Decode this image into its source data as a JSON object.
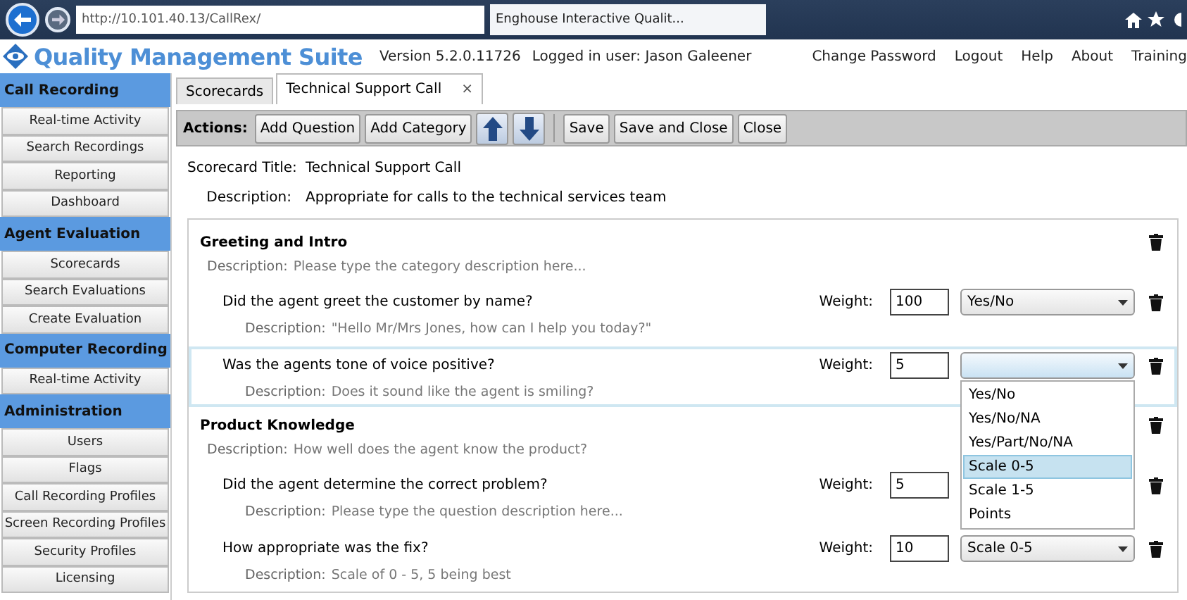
{
  "browser": {
    "address": "http://10.101.40.13/CallRex/",
    "tab_title": "Enghouse Interactive Qualit..."
  },
  "header": {
    "app_title": "Quality Management Suite",
    "version": "Version  5.2.0.11726",
    "user": "Logged in user:  Jason Galeener",
    "links": [
      "Change Password",
      "Logout",
      "Help",
      "About",
      "Training"
    ]
  },
  "sidebar": [
    {
      "title": "Call Recording",
      "items": [
        "Real-time Activity",
        "Search Recordings",
        "Reporting",
        "Dashboard"
      ]
    },
    {
      "title": "Agent Evaluation",
      "items": [
        "Scorecards",
        "Search Evaluations",
        "Create Evaluation"
      ]
    },
    {
      "title": "Computer Recording",
      "items": [
        "Real-time Activity"
      ]
    },
    {
      "title": "Administration",
      "items": [
        "Users",
        "Flags",
        "Call Recording Profiles",
        "Screen Recording Profiles",
        "Security Profiles",
        "Licensing"
      ]
    }
  ],
  "tabs": [
    {
      "label": "Scorecards",
      "selected": false
    },
    {
      "label": "Technical Support Call",
      "selected": true,
      "close": "×"
    }
  ],
  "actions": {
    "label": "Actions:",
    "buttons": [
      {
        "kind": "text",
        "label": "Add Question"
      },
      {
        "kind": "text",
        "label": "Add Category"
      },
      {
        "kind": "up"
      },
      {
        "kind": "down"
      },
      {
        "kind": "separator"
      },
      {
        "kind": "text",
        "label": "Save"
      },
      {
        "kind": "text",
        "label": "Save and Close"
      },
      {
        "kind": "text",
        "label": "Close"
      }
    ]
  },
  "scorecard": {
    "title_label": "Scorecard Title:",
    "title": "Technical Support Call",
    "description_label": "Description:",
    "description": "Appropriate for calls to the technical services team"
  },
  "categories": [
    {
      "name": "Greeting and Intro",
      "description_label": "Description:",
      "description": "Please type the category description here...",
      "questions": [
        {
          "text": "Did the agent greet the customer by name?",
          "description_label": "Description:",
          "description": "\"Hello Mr/Mrs Jones, how can I help you today?\"",
          "weight_label": "Weight:",
          "weight": "100",
          "scale": "Yes/No",
          "selected": false
        },
        {
          "text": "Was the agents tone of voice positive?",
          "description_label": "Description:",
          "description": "Does it sound like the agent is smiling?",
          "weight_label": "Weight:",
          "weight": "5",
          "selected": true
        }
      ]
    },
    {
      "name": "Product Knowledge",
      "description_label": "Description:",
      "description": "How well does the agent know the product?",
      "questions": [
        {
          "text": "Did the agent determine the correct problem?",
          "description_label": "Description:",
          "description": "Please type the question description here...",
          "weight_label": "Weight:",
          "weight": "5",
          "selected": false
        },
        {
          "text": "How appropriate was the fix?",
          "description_label": "Description:",
          "description": "Scale of 0 - 5, 5 being best",
          "weight_label": "Weight:",
          "weight": "10",
          "scale": "Scale 0-5",
          "selected": false
        }
      ]
    }
  ],
  "dropdown": {
    "options": [
      {
        "label": "Yes/No",
        "selected": false
      },
      {
        "label": "Yes/No/NA",
        "selected": false
      },
      {
        "label": "Yes/Part/No/NA",
        "selected": false
      },
      {
        "label": "Scale 0-5",
        "selected": true
      },
      {
        "label": "Scale 1-5",
        "selected": false
      },
      {
        "label": "Points",
        "selected": false
      }
    ]
  }
}
